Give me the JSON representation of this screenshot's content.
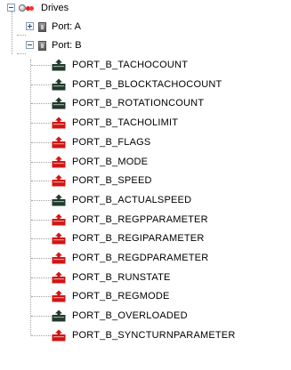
{
  "tree": {
    "root": {
      "label": "Drives",
      "icon": "drives-icon",
      "expanded": true
    },
    "ports": [
      {
        "label": "Port: A",
        "icon": "port-icon",
        "expanded": false
      },
      {
        "label": "Port: B",
        "icon": "port-icon",
        "expanded": true
      }
    ],
    "port_b_items": [
      {
        "label": "PORT_B_TACHOCOUNT",
        "icon": "read-only-parameter-icon",
        "color": "#1f3a2a"
      },
      {
        "label": "PORT_B_BLOCKTACHOCOUNT",
        "icon": "read-only-parameter-icon",
        "color": "#1f3a2a"
      },
      {
        "label": "PORT_B_ROTATIONCOUNT",
        "icon": "read-only-parameter-icon",
        "color": "#1f3a2a"
      },
      {
        "label": "PORT_B_TACHOLIMIT",
        "icon": "writable-parameter-icon",
        "color": "#d01515"
      },
      {
        "label": "PORT_B_FLAGS",
        "icon": "writable-parameter-icon",
        "color": "#d01515"
      },
      {
        "label": "PORT_B_MODE",
        "icon": "writable-parameter-icon",
        "color": "#d01515"
      },
      {
        "label": "PORT_B_SPEED",
        "icon": "writable-parameter-icon",
        "color": "#d01515"
      },
      {
        "label": "PORT_B_ACTUALSPEED",
        "icon": "read-only-parameter-icon",
        "color": "#1f3a2a"
      },
      {
        "label": "PORT_B_REGPPARAMETER",
        "icon": "writable-parameter-icon",
        "color": "#d01515"
      },
      {
        "label": "PORT_B_REGIPARAMETER",
        "icon": "writable-parameter-icon",
        "color": "#d01515"
      },
      {
        "label": "PORT_B_REGDPARAMETER",
        "icon": "writable-parameter-icon",
        "color": "#d01515"
      },
      {
        "label": "PORT_B_RUNSTATE",
        "icon": "writable-parameter-icon",
        "color": "#d01515"
      },
      {
        "label": "PORT_B_REGMODE",
        "icon": "writable-parameter-icon",
        "color": "#d01515"
      },
      {
        "label": "PORT_B_OVERLOADED",
        "icon": "read-only-parameter-icon",
        "color": "#1f3a2a"
      },
      {
        "label": "PORT_B_SYNCTURNPARAMETER",
        "icon": "writable-parameter-icon",
        "color": "#d01515"
      }
    ]
  }
}
